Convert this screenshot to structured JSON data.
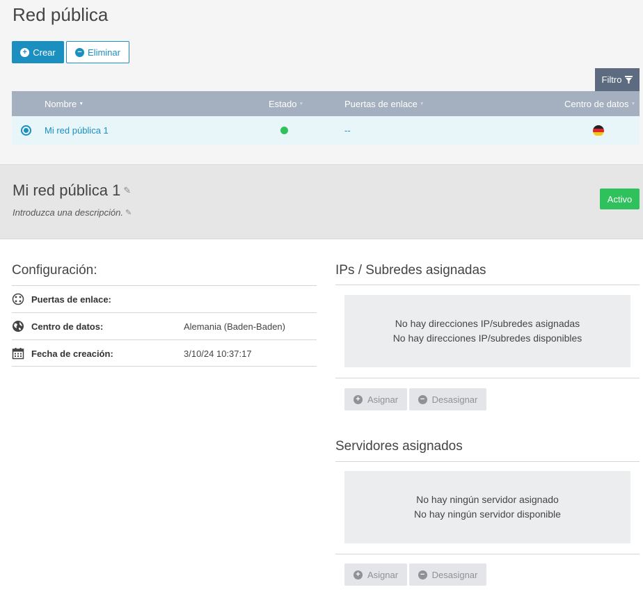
{
  "page": {
    "title": "Red pública"
  },
  "toolbar": {
    "create_label": "Crear",
    "delete_label": "Eliminar",
    "filter_label": "Filtro"
  },
  "table": {
    "columns": {
      "name": "Nombre",
      "status": "Estado",
      "gateways": "Puertas de enlace",
      "datacenter": "Centro de datos"
    },
    "rows": [
      {
        "name": "Mi red pública 1",
        "status": "active",
        "gateways": "--",
        "datacenter_flag": "germany-flag"
      }
    ]
  },
  "detail": {
    "title": "Mi red pública 1",
    "description_placeholder": "Introduzca una descripción.",
    "status_badge": "Activo"
  },
  "config": {
    "heading": "Configuración:",
    "rows": [
      {
        "label": "Puertas de enlace:",
        "value": "",
        "icon": "gateway-icon"
      },
      {
        "label": "Centro de datos:",
        "value": "Alemania (Baden-Baden)",
        "icon": "globe-icon"
      },
      {
        "label": "Fecha de creación:",
        "value": "3/10/24 10:37:17",
        "icon": "calendar-icon"
      }
    ]
  },
  "ips": {
    "heading": "IPs / Subredes asignadas",
    "empty_line1": "No hay direcciones IP/subredes asignadas",
    "empty_line2": "No hay direcciones IP/subredes disponibles",
    "assign_label": "Asignar",
    "unassign_label": "Desasignar"
  },
  "servers": {
    "heading": "Servidores asignados",
    "empty_line1": "No hay ningún servidor asignado",
    "empty_line2": "No hay ningún servidor disponible",
    "assign_label": "Asignar",
    "unassign_label": "Desasignar"
  },
  "colors": {
    "accent": "#1a8fc0",
    "status_active": "#2fc25c",
    "table_header": "#a4afbf",
    "selected_row": "#e8f6f9"
  }
}
